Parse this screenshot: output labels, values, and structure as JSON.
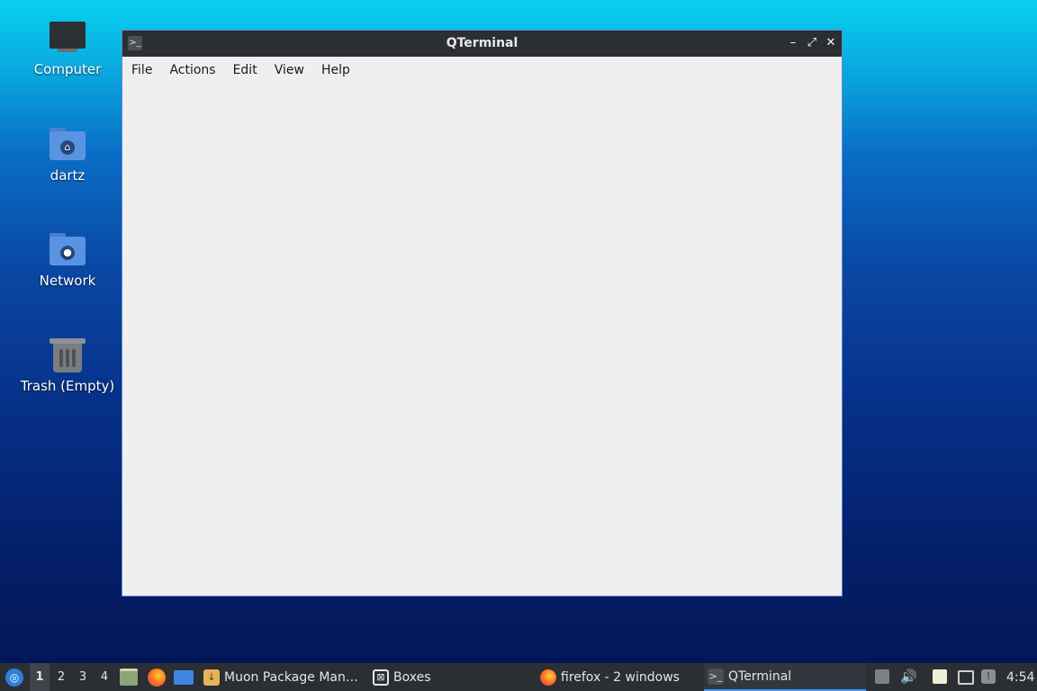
{
  "desktop": {
    "icons": [
      {
        "label": "Computer"
      },
      {
        "label": "dartz"
      },
      {
        "label": "Network"
      },
      {
        "label": "Trash (Empty)"
      }
    ]
  },
  "window": {
    "title": "QTerminal",
    "menu": [
      "File",
      "Actions",
      "Edit",
      "View",
      "Help"
    ],
    "controls": {
      "minimize": "–",
      "maximize": "⤢",
      "close": "✕"
    }
  },
  "taskbar": {
    "desktops": [
      "1",
      "2",
      "3",
      "4"
    ],
    "active_desktop": "1",
    "tasks": [
      {
        "label": "Muon Package Man…",
        "icon": "package-icon"
      },
      {
        "label": "Boxes",
        "icon": "boxes-icon"
      },
      {
        "label": "firefox - 2 windows",
        "icon": "firefox-icon"
      },
      {
        "label": "QTerminal",
        "icon": "terminal-icon",
        "active": true
      }
    ],
    "clock": "4:54"
  },
  "colors": {
    "titlebar": "#2b2e33",
    "window_border": "#5a8bd0",
    "window_bg": "#efefef",
    "taskbar": "#2b2e33",
    "accent": "#4a8ff0"
  }
}
